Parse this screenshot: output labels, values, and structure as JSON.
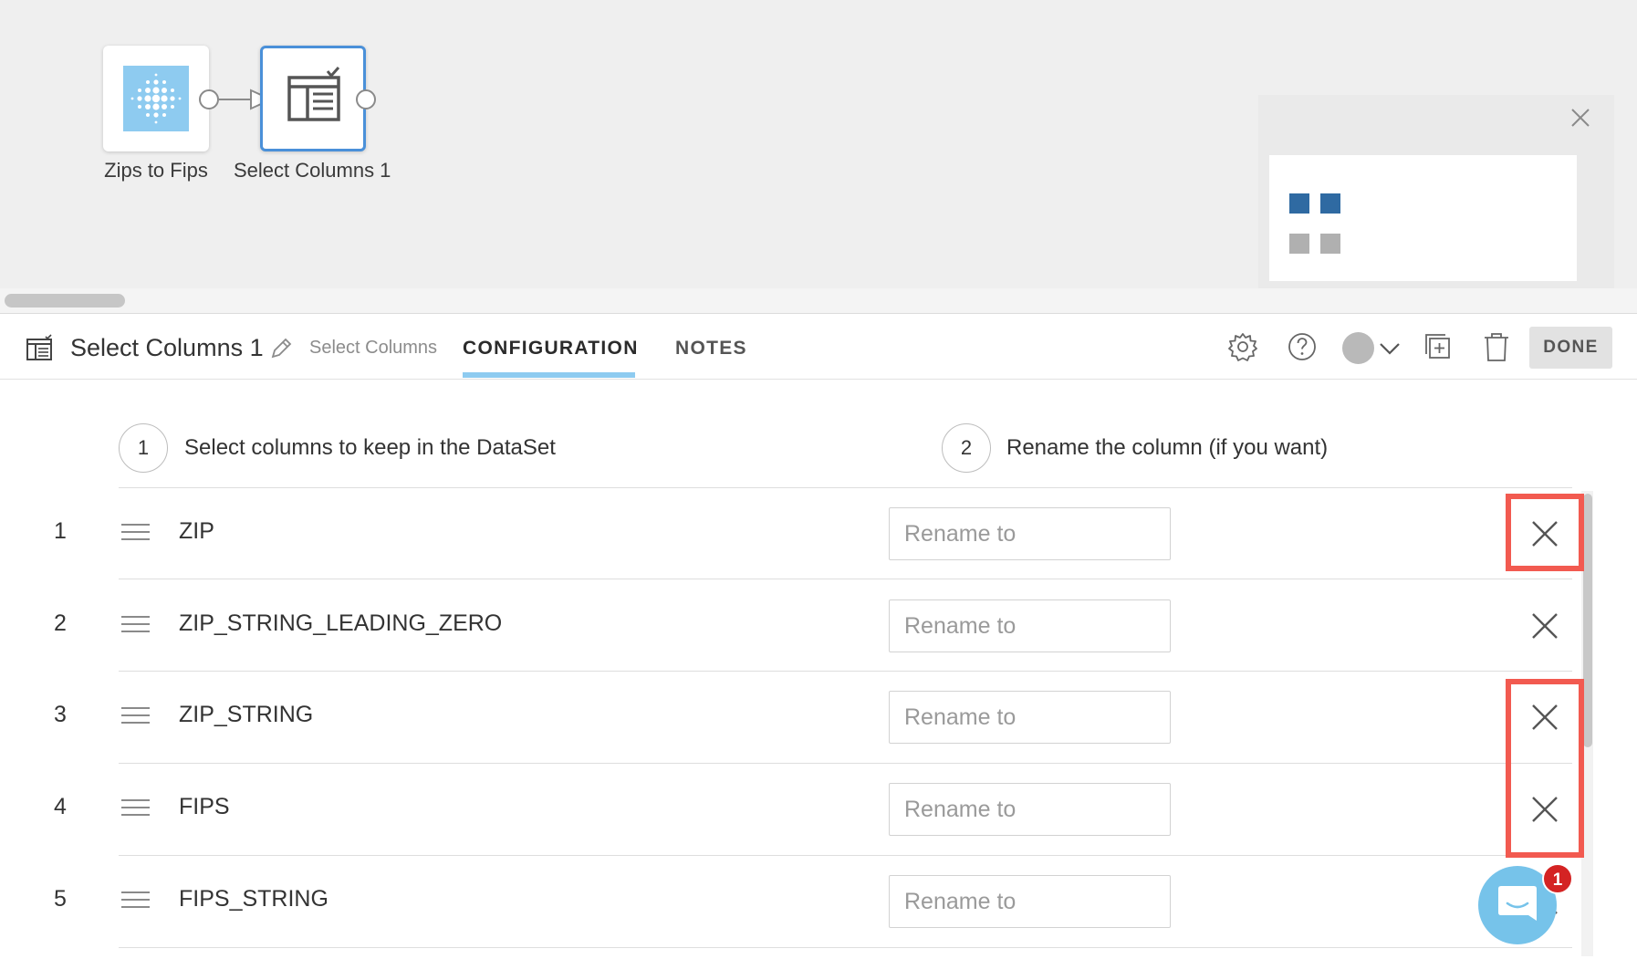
{
  "canvas": {
    "nodes": [
      {
        "label": "Zips to Fips",
        "icon": "dataset-icon"
      },
      {
        "label": "Select Columns 1",
        "icon": "select-columns-icon"
      }
    ],
    "minimap": {
      "close_icon": "close-icon"
    }
  },
  "header": {
    "title": "Select Columns 1",
    "type_label": "Select Columns",
    "tabs": [
      {
        "label": "CONFIGURATION",
        "active": true
      },
      {
        "label": "NOTES",
        "active": false
      }
    ],
    "tools": [
      "gear-icon",
      "help-icon",
      "status-dot-icon",
      "chevron-down-icon",
      "duplicate-icon",
      "trash-icon"
    ],
    "done_label": "DONE"
  },
  "steps": [
    {
      "number": "1",
      "text": "Select columns to keep in the DataSet"
    },
    {
      "number": "2",
      "text": "Rename the column (if you want)"
    }
  ],
  "rows": [
    {
      "index": "1",
      "name": "ZIP",
      "rename_placeholder": "Rename to",
      "highlighted": true
    },
    {
      "index": "2",
      "name": "ZIP_STRING_LEADING_ZERO",
      "rename_placeholder": "Rename to",
      "highlighted": false
    },
    {
      "index": "3",
      "name": "ZIP_STRING",
      "rename_placeholder": "Rename to",
      "highlighted": true
    },
    {
      "index": "4",
      "name": "FIPS",
      "rename_placeholder": "Rename to",
      "highlighted": true
    },
    {
      "index": "5",
      "name": "FIPS_STRING",
      "rename_placeholder": "Rename to",
      "highlighted": false
    }
  ],
  "chat": {
    "badge_count": "1"
  },
  "colors": {
    "accent": "#8ecbf0",
    "node_selected_border": "#4a90d9",
    "highlight": "#f25a50",
    "minimap_active": "#2f6aa2",
    "minimap_inactive": "#b0b0b0",
    "badge": "#d42323"
  }
}
